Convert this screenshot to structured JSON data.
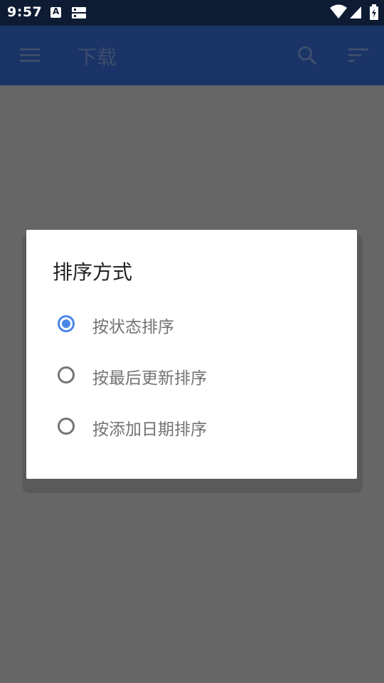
{
  "status_bar": {
    "time": "9:57",
    "icons": [
      "app-notification-icon",
      "storage-notification-icon",
      "wifi-icon",
      "signal-icon",
      "battery-charging-icon"
    ]
  },
  "app_bar": {
    "title": "下载",
    "icons": [
      "menu-icon",
      "search-icon",
      "sort-icon"
    ]
  },
  "dialog": {
    "title": "排序方式",
    "options": [
      {
        "label": "按状态排序",
        "checked": true
      },
      {
        "label": "按最后更新排序",
        "checked": false
      },
      {
        "label": "按添加日期排序",
        "checked": false
      }
    ]
  },
  "colors": {
    "status_bar": "#0d1b33",
    "app_bar": "#1a3467",
    "scrim": "#666666",
    "accent": "#4a86e8"
  }
}
